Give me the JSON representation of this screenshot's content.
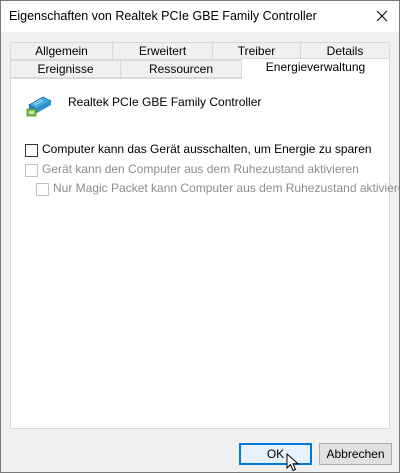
{
  "window": {
    "title": "Eigenschaften von Realtek PCIe GBE Family Controller"
  },
  "tabs": {
    "row1": [
      {
        "label": "Allgemein"
      },
      {
        "label": "Erweitert"
      },
      {
        "label": "Treiber"
      },
      {
        "label": "Details"
      }
    ],
    "row2": [
      {
        "label": "Ereignisse"
      },
      {
        "label": "Ressourcen"
      },
      {
        "label": "Energieverwaltung",
        "active": true
      }
    ]
  },
  "device": {
    "name": "Realtek PCIe GBE Family Controller",
    "icon": "network-adapter-icon"
  },
  "options": [
    {
      "label": "Computer kann das Gerät ausschalten, um Energie zu sparen",
      "checked": false,
      "enabled": true
    },
    {
      "label": "Gerät kann den Computer aus dem Ruhezustand aktivieren",
      "checked": false,
      "enabled": false
    },
    {
      "label": "Nur Magic Packet kann Computer aus dem Ruhezustand aktivieren",
      "checked": false,
      "enabled": false
    }
  ],
  "buttons": {
    "ok": "OK",
    "cancel": "Abbrechen"
  },
  "colors": {
    "accent": "#0078d7",
    "disabled_text": "#8d8d8d"
  }
}
